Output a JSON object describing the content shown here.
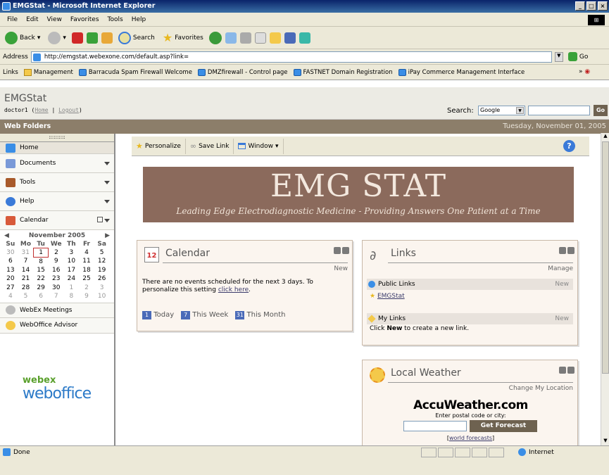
{
  "window": {
    "title": "EMGStat - Microsoft Internet Explorer"
  },
  "menu": [
    "File",
    "Edit",
    "View",
    "Favorites",
    "Tools",
    "Help"
  ],
  "toolbar": {
    "back": "Back",
    "search": "Search",
    "favorites": "Favorites"
  },
  "address": {
    "label": "Address",
    "url": "http://emgstat.webexone.com/default.asp?link=",
    "go": "Go"
  },
  "links_bar": {
    "label": "Links",
    "items": [
      "Management",
      "Barracuda Spam Firewall Welcome",
      "DMZfirewall - Control page",
      "FASTNET Domain Registration",
      "iPay Commerce Management Interface"
    ]
  },
  "site": {
    "title": "EMGStat",
    "user": "doctor1",
    "home_link": "Home",
    "logout_link": "Logout",
    "search_label": "Search:",
    "search_engine": "Google",
    "search_go": "Go",
    "section": "Web Folders",
    "date": "Tuesday, November 01, 2005"
  },
  "sidebar": {
    "grip": "::::::::::",
    "items": [
      "Home",
      "Documents",
      "Tools",
      "Help"
    ],
    "calendar_label": "Calendar",
    "calendar": {
      "month": "November 2005",
      "days": [
        "Su",
        "Mo",
        "Tu",
        "We",
        "Th",
        "Fr",
        "Sa"
      ],
      "weeks": [
        [
          "30",
          "31",
          "1",
          "2",
          "3",
          "4",
          "5"
        ],
        [
          "6",
          "7",
          "8",
          "9",
          "10",
          "11",
          "12"
        ],
        [
          "13",
          "14",
          "15",
          "16",
          "17",
          "18",
          "19"
        ],
        [
          "20",
          "21",
          "22",
          "23",
          "24",
          "25",
          "26"
        ],
        [
          "27",
          "28",
          "29",
          "30",
          "1",
          "2",
          "3"
        ],
        [
          "4",
          "5",
          "6",
          "7",
          "8",
          "9",
          "10"
        ]
      ]
    },
    "extra_items": [
      "WebEx Meetings",
      "WebOffice Advisor"
    ],
    "logo": {
      "top": "webex",
      "bottom": "weboffice"
    }
  },
  "portal_toolbar": {
    "personalize": "Personalize",
    "save_link": "Save Link",
    "window": "Window",
    "help": "?"
  },
  "banner": {
    "title": "EMG STAT",
    "tagline": "Leading Edge Electrodiagnostic Medicine - Providing Answers One Patient at a Time"
  },
  "calendar_panel": {
    "title": "Calendar",
    "icon_day": "12",
    "action": "New",
    "message": "There are no events scheduled for the next 3 days. To personalize this setting",
    "link": "click here",
    "message_end": ".",
    "views": [
      {
        "icon": "1",
        "label": "Today"
      },
      {
        "icon": "7",
        "label": "This Week"
      },
      {
        "icon": "31",
        "label": "This Month"
      }
    ]
  },
  "links_panel": {
    "title": "Links",
    "action": "Manage",
    "public_label": "Public Links",
    "public_new": "New",
    "public_item": "EMGStat",
    "my_label": "My Links",
    "my_new": "New",
    "my_text_pre": "Click ",
    "my_text_bold": "New",
    "my_text_post": " to create a new link."
  },
  "weather_panel": {
    "title": "Local Weather",
    "action": "Change My Location",
    "brand": "AccuWeather.com",
    "prompt": "Enter postal code or city:",
    "button": "Get Forecast",
    "link_pre": "[",
    "link": "world forecasts",
    "link_post": "]"
  },
  "status": {
    "left": "Done",
    "zone": "Internet"
  }
}
